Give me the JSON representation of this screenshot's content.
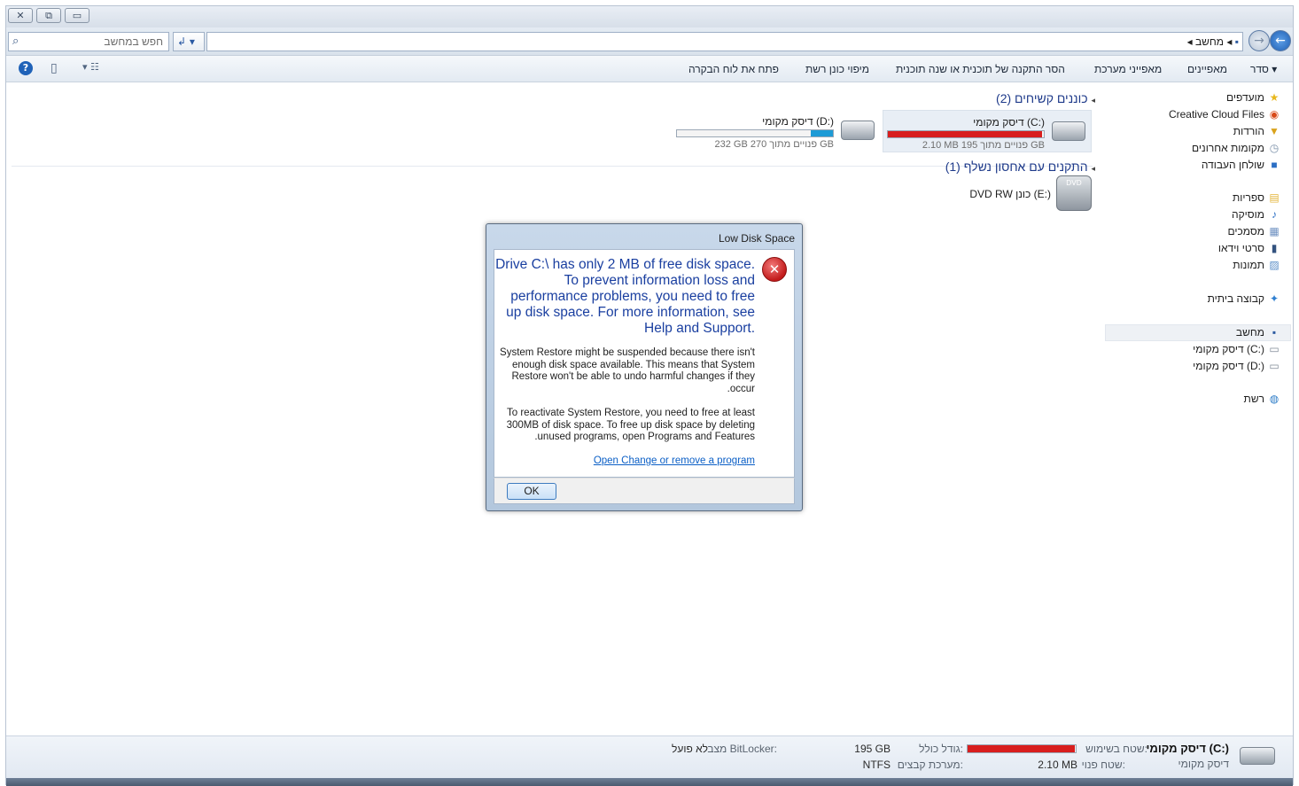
{
  "window": {
    "close_glyph": "✕",
    "restore_glyph": "⧉",
    "minimize_glyph": "▭"
  },
  "address": {
    "search_placeholder": "חפש במחשב",
    "breadcrumb": "◂ מחשב ◂",
    "refresh_glyph": "↲ ▾"
  },
  "toolbar": {
    "organize": "סדר ▾",
    "properties": "מאפיינים",
    "system_properties": "מאפייני מערכת",
    "uninstall": "הסר התקנה של תוכנית או שנה תוכנית",
    "map_drive": "מיפוי כונן רשת",
    "control_panel": "פתח את לוח הבקרה"
  },
  "nav": {
    "favorites": "מועדפים",
    "creative_cloud": "Creative Cloud Files",
    "downloads": "הורדות",
    "recent_places": "מקומות אחרונים",
    "desktop": "שולחן העבודה",
    "libraries": "ספריות",
    "music": "מוסיקה",
    "documents": "מסמכים",
    "videos": "סרטי וידאו",
    "pictures": "תמונות",
    "homegroup": "קבוצה ביתית",
    "computer": "מחשב",
    "drive_c": "דיסק מקומי (C:)",
    "drive_d": "דיסק מקומי (D:)",
    "network": "רשת"
  },
  "content": {
    "hard_drives_header": "כוננים קשיחים (2)",
    "removable_header": "התקנים עם אחסון נשלף (1)",
    "drive_c": {
      "name": "דיסק מקומי (C:)",
      "info": "2.10 MB פנויים מתוך 195 GB",
      "used_fraction": 0.99,
      "bar_color": "#d81e1e"
    },
    "drive_d": {
      "name": "דיסק מקומי (D:)",
      "info": "232 GB פנויים מתוך 270 GB",
      "used_fraction": 0.14,
      "bar_color": "#1e9bd6"
    },
    "dvd": {
      "name": "DVD RW כונן (E:)",
      "label": "DVD"
    }
  },
  "details": {
    "title": "דיסק מקומי (C:)",
    "type": "דיסק מקומי",
    "used_label": "שטח בשימוש:",
    "free_label": "שטח פנוי:",
    "free_value": "2.10 MB",
    "total_label": "גודל כולל:",
    "total_value": "195 GB",
    "fs_label": "מערכת קבצים:",
    "fs_value": "NTFS",
    "bitlocker_label": "מצב BitLocker:",
    "bitlocker_value": "לא פועל",
    "used_fraction": 0.99
  },
  "dialog": {
    "title": "Low Disk Space",
    "error_glyph": "✕",
    "main_lines": [
      ".Drive C:\\ has only 2 MB of free disk space",
      "To prevent information loss and",
      "performance problems, you need to free",
      "up disk space. For more information, see",
      ".Help and Support"
    ],
    "para1_lines": [
      "System Restore might be suspended because there isn't",
      "enough disk space available. This means that System",
      "Restore won't be able to undo harmful changes if they",
      ".occur"
    ],
    "para2_lines": [
      "To reactivate System Restore, you need to free at least",
      "300MB of disk space. To free up disk space by deleting",
      ".unused programs, open Programs and Features"
    ],
    "link": "Open Change or remove a program",
    "ok": "OK"
  },
  "colors": {
    "accent": "#1e3a8a",
    "link": "#0b5fc6",
    "danger": "#d81e1e"
  }
}
